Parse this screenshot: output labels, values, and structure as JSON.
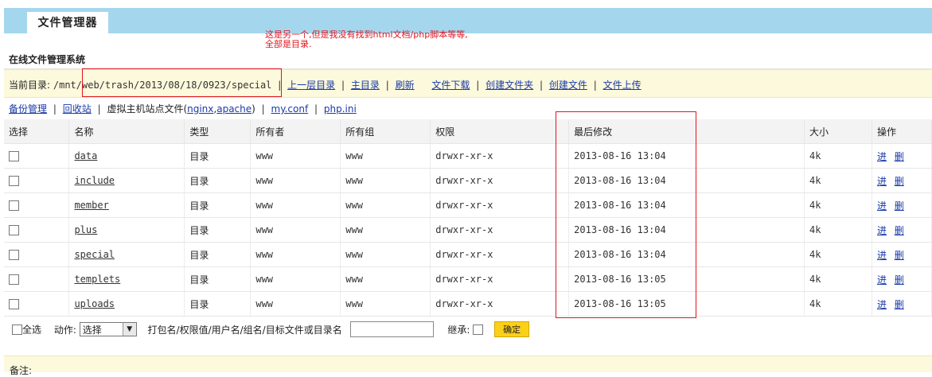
{
  "header": {
    "tab_title": "文件管理器"
  },
  "annotation": {
    "line1": "这是另一个,但是我没有找到html文档/php脚本等等,",
    "line2": "全部是目录."
  },
  "section_title": "在线文件管理系统",
  "path_bar": {
    "label": "当前目录:",
    "path": "/mnt/web/trash/2013/08/18/0923/special",
    "links": [
      "上一层目录",
      "主目录",
      "刷新",
      "文件下载",
      "创建文件夹",
      "创建文件",
      "文件上传"
    ]
  },
  "tools": {
    "backup": "备份管理",
    "recycle": "回收站",
    "vhost_prefix": "虚拟主机站点文件(",
    "nginx": "nginx",
    "comma": ",",
    "apache": "apache",
    "vhost_suffix": ")",
    "myconf": "my.conf",
    "phpini": "php.ini"
  },
  "table": {
    "headers": [
      "选择",
      "名称",
      "类型",
      "所有者",
      "所有组",
      "权限",
      "最后修改",
      "大小",
      "操作"
    ],
    "rows": [
      {
        "name": "data",
        "type": "目录",
        "owner": "www",
        "group": "www",
        "perm": "drwxr-xr-x",
        "mtime": "2013-08-16 13:04",
        "size": "4k",
        "op_enter": "进",
        "op_delete": "删"
      },
      {
        "name": "include",
        "type": "目录",
        "owner": "www",
        "group": "www",
        "perm": "drwxr-xr-x",
        "mtime": "2013-08-16 13:04",
        "size": "4k",
        "op_enter": "进",
        "op_delete": "删"
      },
      {
        "name": "member",
        "type": "目录",
        "owner": "www",
        "group": "www",
        "perm": "drwxr-xr-x",
        "mtime": "2013-08-16 13:04",
        "size": "4k",
        "op_enter": "进",
        "op_delete": "删"
      },
      {
        "name": "plus",
        "type": "目录",
        "owner": "www",
        "group": "www",
        "perm": "drwxr-xr-x",
        "mtime": "2013-08-16 13:04",
        "size": "4k",
        "op_enter": "进",
        "op_delete": "删"
      },
      {
        "name": "special",
        "type": "目录",
        "owner": "www",
        "group": "www",
        "perm": "drwxr-xr-x",
        "mtime": "2013-08-16 13:04",
        "size": "4k",
        "op_enter": "进",
        "op_delete": "删"
      },
      {
        "name": "templets",
        "type": "目录",
        "owner": "www",
        "group": "www",
        "perm": "drwxr-xr-x",
        "mtime": "2013-08-16 13:05",
        "size": "4k",
        "op_enter": "进",
        "op_delete": "删"
      },
      {
        "name": "uploads",
        "type": "目录",
        "owner": "www",
        "group": "www",
        "perm": "drwxr-xr-x",
        "mtime": "2013-08-16 13:05",
        "size": "4k",
        "op_enter": "进",
        "op_delete": "删"
      }
    ]
  },
  "bottom": {
    "select_all": "全选",
    "action_label": "动作:",
    "action_value": "选择",
    "param_label": "打包名/权限值/用户名/组名/目标文件或目录名",
    "inherit_label": "继承:",
    "confirm": "确定"
  },
  "note": {
    "label": "备注:"
  },
  "colors": {
    "header_bar": "#a4d7ee",
    "path_bg": "#fcf9dc",
    "link": "#1a3aa8",
    "annotation": "#e0141f",
    "button": "#fbd019"
  }
}
